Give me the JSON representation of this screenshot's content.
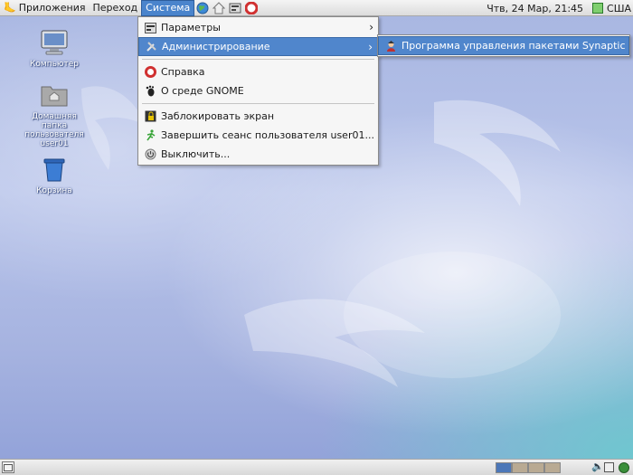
{
  "top_panel": {
    "menus": [
      "Приложения",
      "Переход",
      "Система"
    ],
    "clock": "Чтв, 24 Мар, 21:45",
    "keyboard_layout": "США"
  },
  "desktop_icons": [
    {
      "label": "Компьютер"
    },
    {
      "label": "Домашняя папка пользователя user01"
    },
    {
      "label": "Корзина"
    }
  ],
  "system_menu": {
    "items": [
      {
        "label": "Параметры",
        "icon": "preferences-icon",
        "submenu": true
      },
      {
        "label": "Администрирование",
        "icon": "tools-icon",
        "submenu": true,
        "highlighted": true
      },
      {
        "label": "Справка",
        "icon": "help-icon"
      },
      {
        "label": "О среде GNOME",
        "icon": "gnome-foot-icon"
      },
      {
        "label": "Заблокировать экран",
        "icon": "lock-screen-icon"
      },
      {
        "label": "Завершить сеанс пользователя user01...",
        "icon": "logout-icon"
      },
      {
        "label": "Выключить...",
        "icon": "power-icon"
      }
    ]
  },
  "admin_submenu": {
    "items": [
      {
        "label": "Программа управления пакетами Synaptic",
        "icon": "synaptic-icon",
        "highlighted": true
      }
    ]
  },
  "colors": {
    "highlight": "#5086cc",
    "panel": "#e6e6e6",
    "desktop": "#a9b7e2"
  }
}
